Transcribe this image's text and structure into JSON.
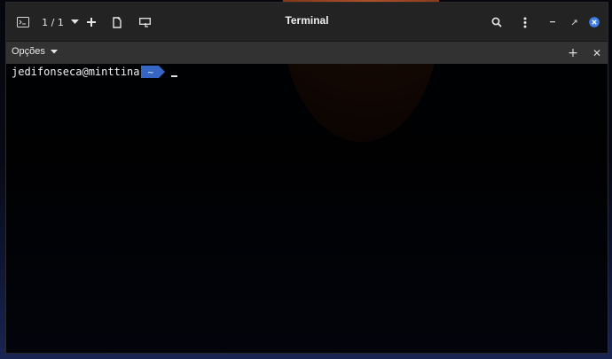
{
  "window": {
    "title": "Terminal"
  },
  "toolbar": {
    "tab_counter": "1 / 1",
    "icons": {
      "terminal": "terminal-icon",
      "dropdown": "chevron-down-icon",
      "new_tab": "plus-icon",
      "new_window": "new-window-icon",
      "split": "split-icon",
      "search": "search-icon",
      "menu": "kebab-menu-icon",
      "minimize": "minimize-icon",
      "maximize": "maximize-icon",
      "close": "close-icon"
    }
  },
  "tabbar": {
    "options_label": "Opções",
    "add_symbol": "+",
    "close_symbol": "✕"
  },
  "terminal": {
    "user_host": "jedifonseca@minttina",
    "directory": "~",
    "cursor": "_"
  },
  "colors": {
    "prompt_segment": "#3566c4",
    "headerbar": "#232323",
    "tabbar": "#323232",
    "close_button": "#3d7ee6"
  }
}
